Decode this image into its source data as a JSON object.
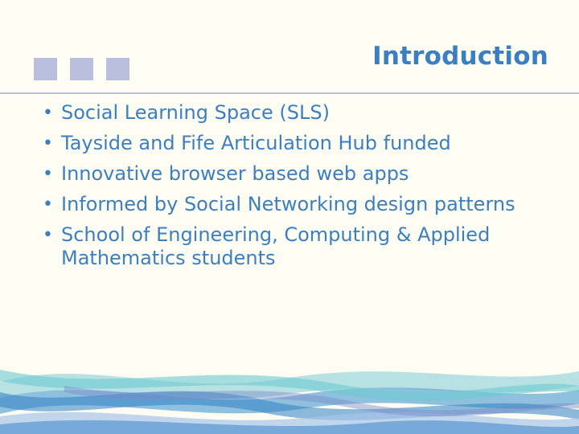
{
  "slide": {
    "title": "Introduction",
    "bullets": [
      {
        "text": "Social Learning Space (SLS)"
      },
      {
        "text": "Tayside and Fife Articulation Hub funded"
      },
      {
        "text": "Innovative browser based web apps"
      },
      {
        "text": "Informed by Social Networking design patterns"
      },
      {
        "text": "School of Engineering, Computing & Applied Mathematics students"
      }
    ]
  },
  "colors": {
    "background": "#fdfdf4",
    "accent": "#3c7fc1",
    "square": "#b9bedc"
  }
}
